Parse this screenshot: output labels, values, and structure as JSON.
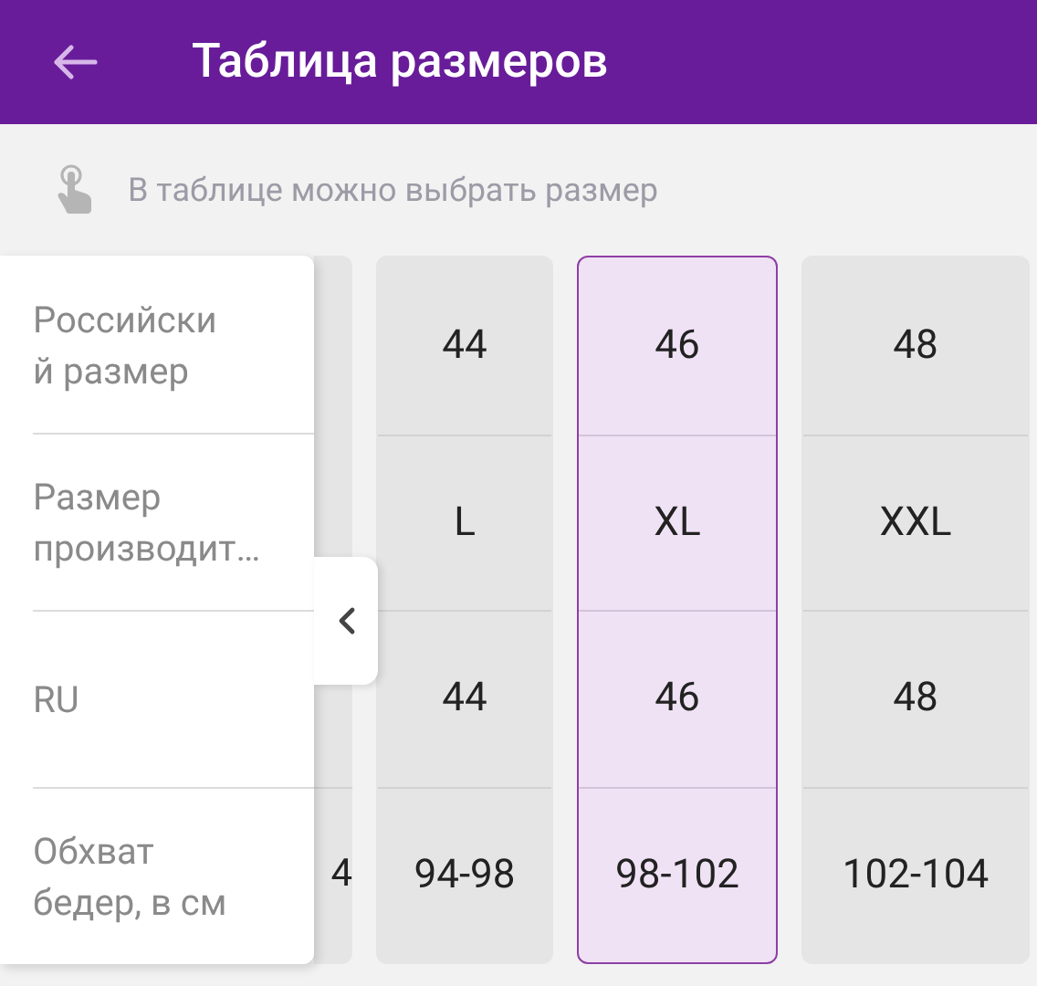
{
  "header": {
    "title": "Таблица размеров"
  },
  "hint": "В таблице можно выбрать размер",
  "row_labels": [
    "Российски\nй размер",
    "Размер\nпроизводит…",
    "RU",
    "Обхват\nбедер, в см"
  ],
  "covered_column": {
    "last_cell": "4"
  },
  "columns": [
    {
      "selected": false,
      "cells": [
        "44",
        "L",
        "44",
        "94-98"
      ]
    },
    {
      "selected": true,
      "cells": [
        "46",
        "XL",
        "46",
        "98-102"
      ]
    },
    {
      "selected": false,
      "cells": [
        "48",
        "XXL",
        "48",
        "102-104"
      ]
    }
  ]
}
